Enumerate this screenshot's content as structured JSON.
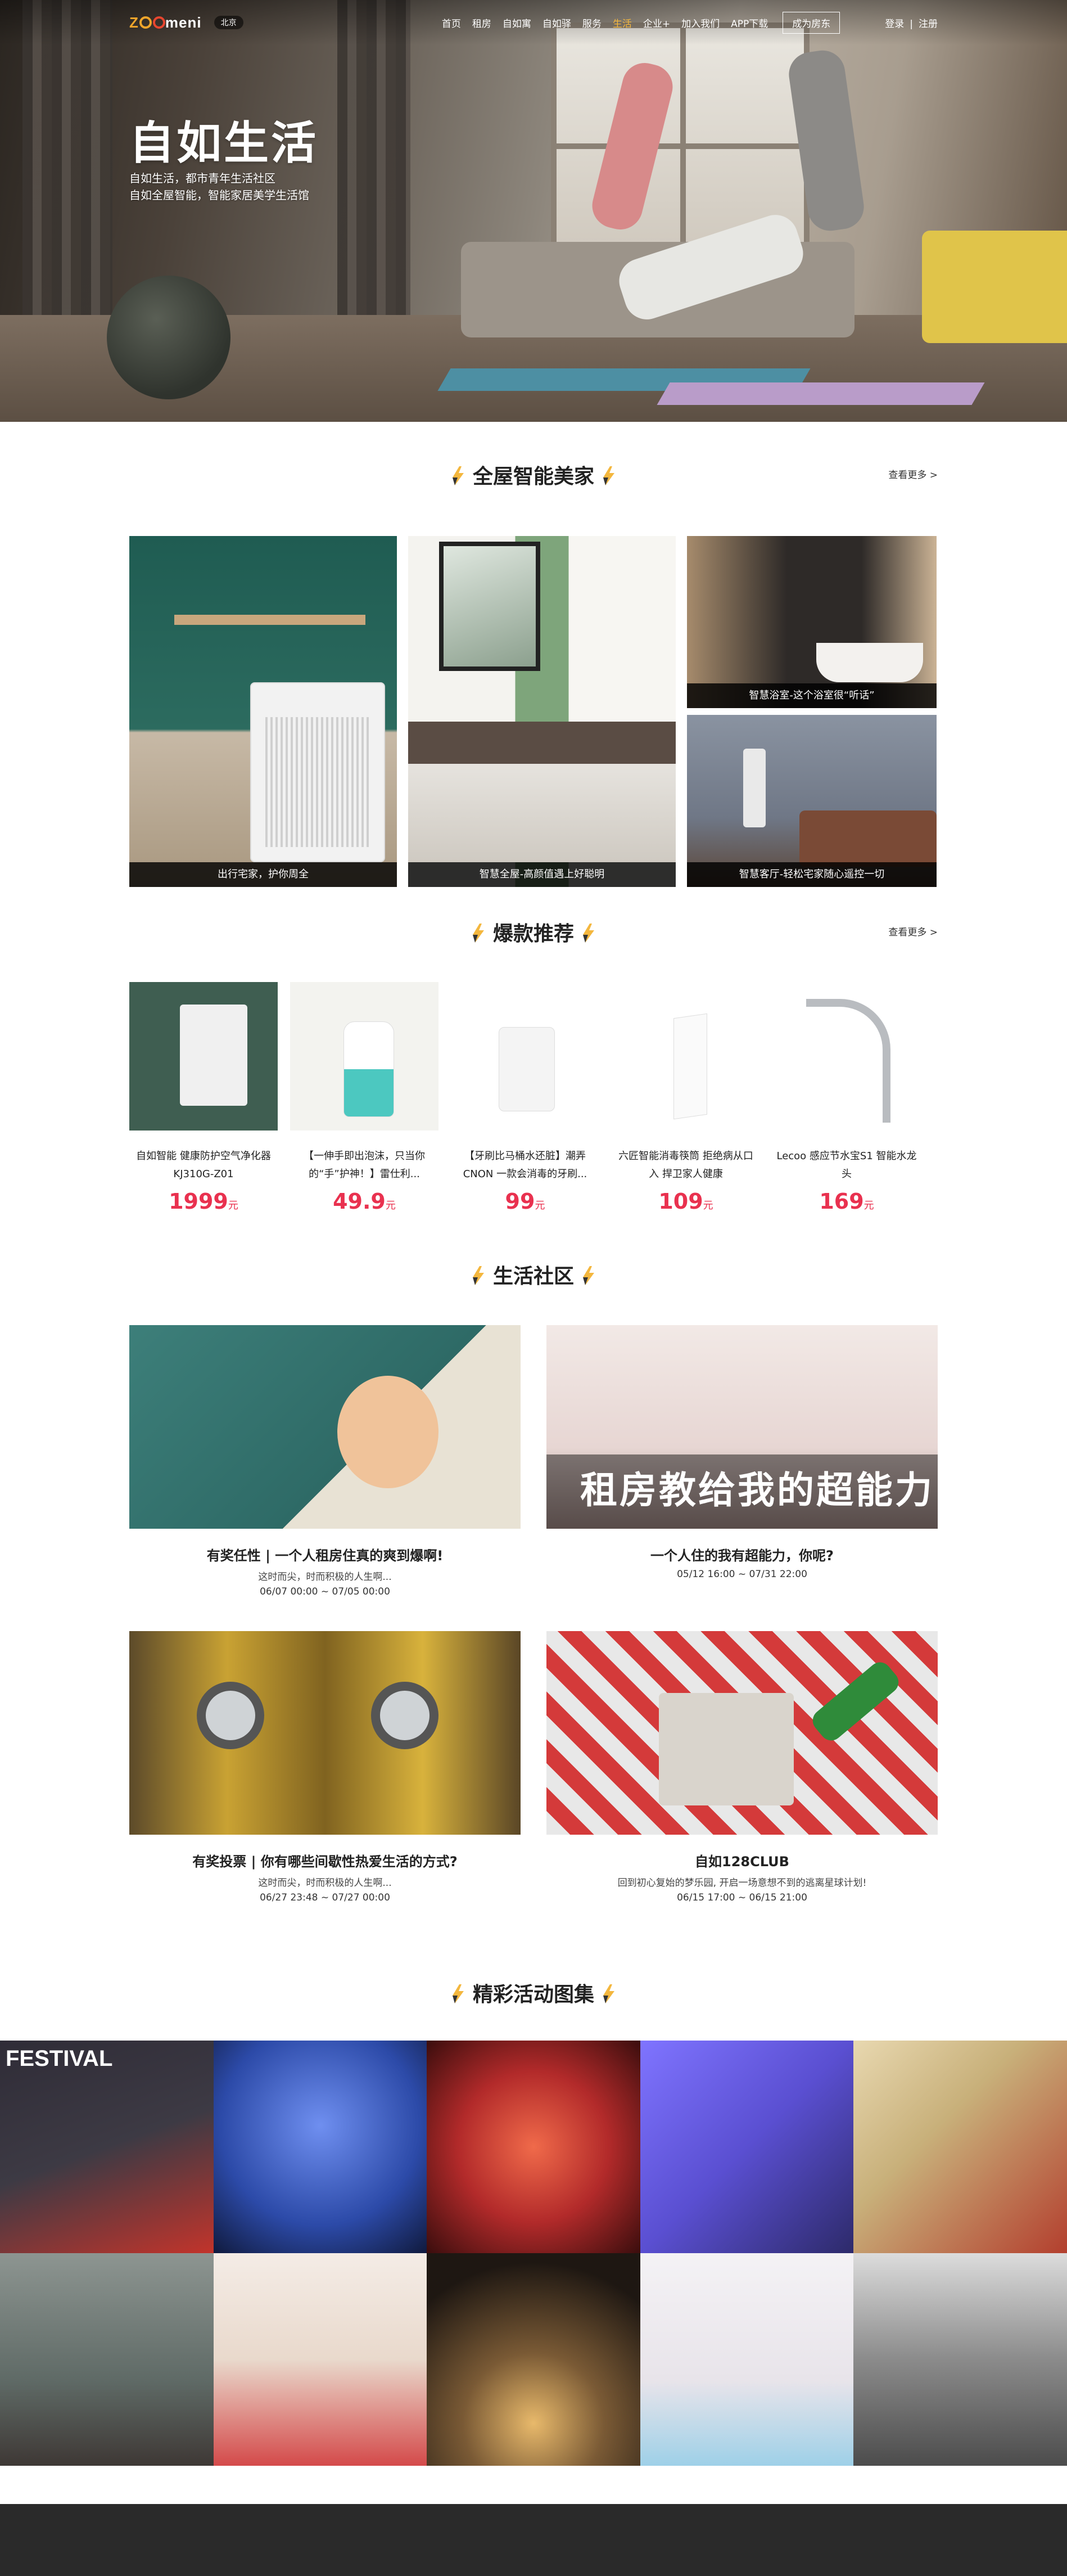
{
  "header": {
    "logo_text": "meni",
    "city": "北京",
    "nav_items": [
      {
        "label": "首页",
        "active": false
      },
      {
        "label": "租房",
        "active": false
      },
      {
        "label": "自如寓",
        "active": false
      },
      {
        "label": "自如驿",
        "active": false
      },
      {
        "label": "服务",
        "active": false
      },
      {
        "label": "生活",
        "active": true
      },
      {
        "label": "企业+",
        "active": false
      },
      {
        "label": "加入我们",
        "active": false
      },
      {
        "label": "APP下载",
        "active": false
      }
    ],
    "join_label": "成为房东",
    "login_label": "登录",
    "separator": "|",
    "register_label": "注册"
  },
  "hero": {
    "title": "自如生活",
    "subtitle_line1": "自如生活，都市青年生活社区",
    "subtitle_line2": "自如全屋智能，智能家居美学生活馆"
  },
  "smart_home": {
    "title": "全屋智能美家",
    "more_label": "查看更多 >",
    "tiles": [
      {
        "caption": "出行宅家，护你周全"
      },
      {
        "caption": "智慧全屋-高颜值遇上好聪明"
      },
      {
        "caption": "智慧浴室-这个浴室很“听话”"
      },
      {
        "caption": "智慧客厅-轻松宅家随心遥控一切"
      }
    ]
  },
  "hot": {
    "title": "爆款推荐",
    "more_label": "查看更多 >",
    "price_unit": "元",
    "products": [
      {
        "name": "自如智能 健康防护空气净化器KJ310G-Z01",
        "price": "1999"
      },
      {
        "name": "【一伸手即出泡沫，只当你的“手”护神！】雷仕利...",
        "price": "49.9"
      },
      {
        "name": "【牙刷比马桶水还脏】潮弄CNON 一款会消毒的牙刷...",
        "price": "99"
      },
      {
        "name": "六匠智能消毒筷筒 拒绝病从口入 捍卫家人健康",
        "price": "109"
      },
      {
        "name": "Lecoo 感应节水宝S1 智能水龙头",
        "price": "169"
      }
    ]
  },
  "community": {
    "title": "生活社区",
    "posts": [
      {
        "title": "有奖任性 | 一个人租房住真的爽到爆啊!",
        "desc": "这时而尖，时而积极的人生啊...",
        "date": "06/07 00:00 ~ 07/05 00:00",
        "overlay": ""
      },
      {
        "title": "一个人住的我有超能力，你呢?",
        "desc": "",
        "date": "05/12 16:00 ~ 07/31 22:00",
        "overlay": "租房教给我的超能力"
      },
      {
        "title": "有奖投票 | 你有哪些间歇性热爱生活的方式?",
        "desc": "这时而尖，时而积极的人生啊...",
        "date": "06/27 23:48 ~ 07/27 00:00",
        "overlay": ""
      },
      {
        "title": "自如128CLUB",
        "desc": "回到初心复始的梦乐园, 开启一场意想不到的逃离星球计划!",
        "date": "06/15 17:00 ~ 06/15 21:00",
        "overlay": ""
      }
    ]
  },
  "gallery": {
    "title": "精彩活动图集",
    "festival_text": "FESTIVAL",
    "colors": [
      "#3d3a44",
      "#2c4aa8",
      "#b22a2a",
      "#5a4fd1",
      "#c8b07a",
      "#5f6a66",
      "#e9d9cc",
      "#3a2e26",
      "#e8e4ea",
      "#8b8b8b"
    ]
  },
  "colors": {
    "accent": "#f4b73e",
    "price": "#e9314f",
    "caption_bg": "#000000",
    "footer": "#2a2a2a"
  }
}
